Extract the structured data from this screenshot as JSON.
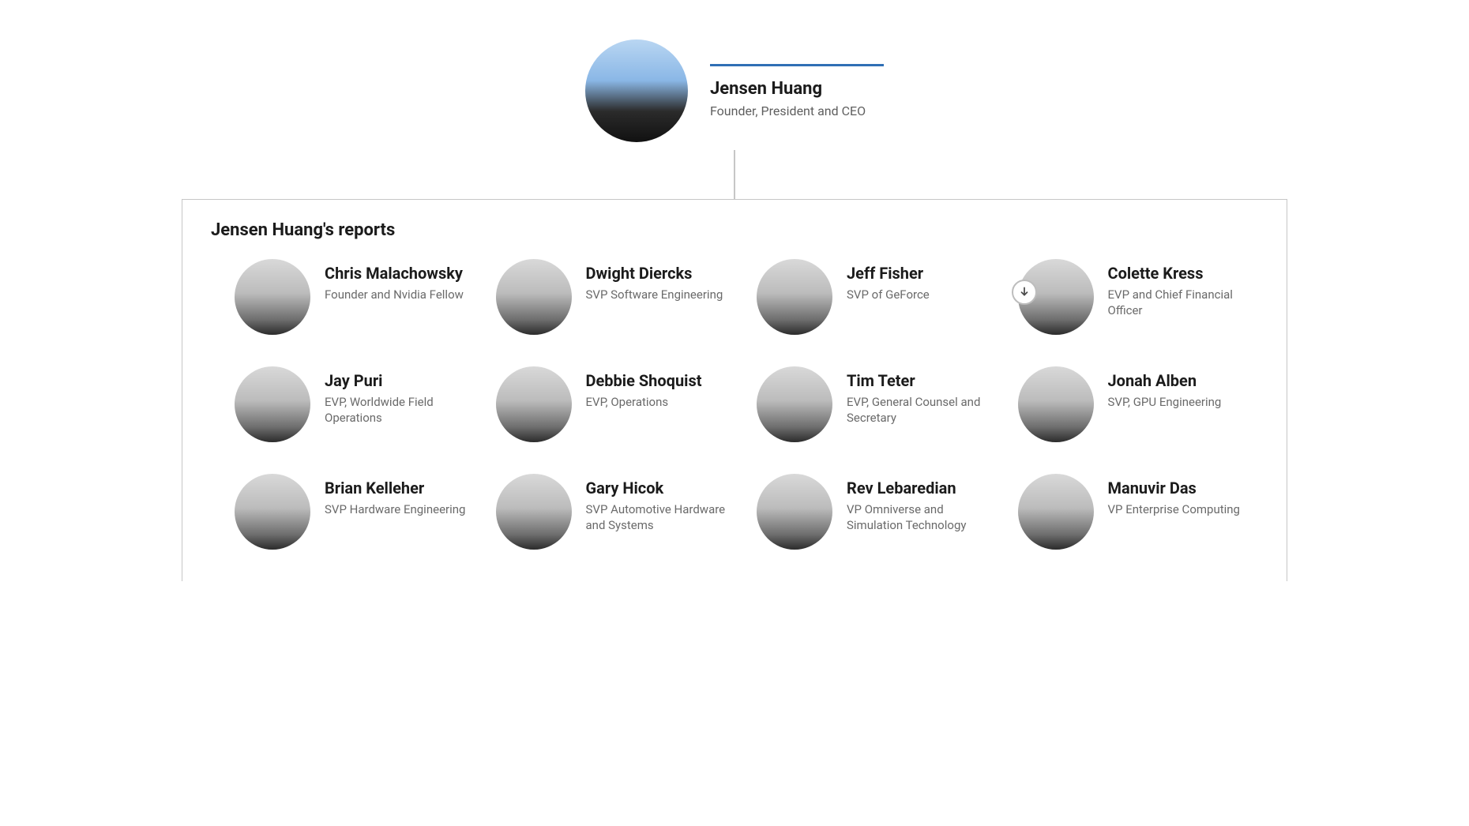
{
  "leader": {
    "name": "Jensen Huang",
    "title": "Founder, President and CEO"
  },
  "reports_heading": "Jensen Huang's reports",
  "reports": [
    {
      "name": "Chris Malachowsky",
      "title": "Founder and Nvidia Fellow",
      "expandable": false
    },
    {
      "name": "Dwight Diercks",
      "title": "SVP Software Engineering",
      "expandable": false
    },
    {
      "name": "Jeff Fisher",
      "title": "SVP of GeForce",
      "expandable": false
    },
    {
      "name": "Colette Kress",
      "title": "EVP and Chief Financial Officer",
      "expandable": true
    },
    {
      "name": "Jay Puri",
      "title": "EVP, Worldwide Field Operations",
      "expandable": false
    },
    {
      "name": "Debbie Shoquist",
      "title": "EVP, Operations",
      "expandable": false
    },
    {
      "name": "Tim Teter",
      "title": "EVP, General Counsel and Secretary",
      "expandable": false
    },
    {
      "name": "Jonah Alben",
      "title": "SVP, GPU Engineering",
      "expandable": false
    },
    {
      "name": "Brian Kelleher",
      "title": "SVP Hardware Engineering",
      "expandable": false
    },
    {
      "name": "Gary Hicok",
      "title": "SVP Automotive Hardware and Systems",
      "expandable": false
    },
    {
      "name": "Rev Lebaredian",
      "title": "VP Omniverse and Simulation Technology",
      "expandable": false
    },
    {
      "name": "Manuvir Das",
      "title": "VP Enterprise Computing",
      "expandable": false
    }
  ]
}
